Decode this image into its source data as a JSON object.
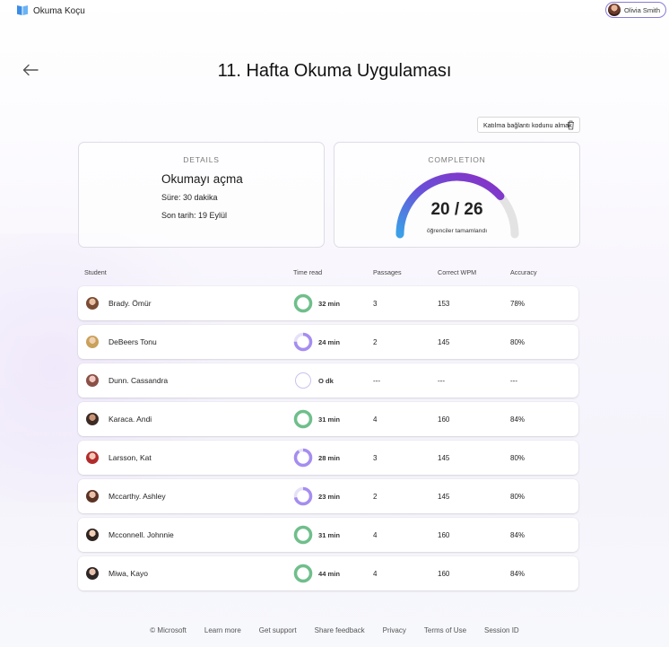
{
  "app": {
    "title": "Okuma Koçu"
  },
  "user": {
    "name": "Olivia Smith"
  },
  "page": {
    "title": "11. Hafta Okuma Uygulaması"
  },
  "actions": {
    "copy_label": "Katılma bağlantı kodunu almak"
  },
  "details": {
    "label": "DETAILS",
    "title": "Okumayı açma",
    "duration": "Süre: 30 dakika",
    "due": "Son tarih: 19 Eylül"
  },
  "completion": {
    "label": "COMPLETION",
    "value": "20 / 26",
    "completed": 20,
    "total": 26,
    "caption": "öğrenciler tamamlandı"
  },
  "table": {
    "headers": {
      "student": "Student",
      "time": "Time read",
      "passages": "Passages",
      "wpm": "Correct WPM",
      "accuracy": "Accuracy"
    },
    "rows": [
      {
        "name": "Brady. Ömür",
        "time": "32 min",
        "passages": "3",
        "wpm": "153",
        "accuracy": "78%",
        "progress": 1.0,
        "color": "#6fbf8a"
      },
      {
        "name": "DeBeers Tonu",
        "time": "24 min",
        "passages": "2",
        "wpm": "145",
        "accuracy": "80%",
        "progress": 0.75,
        "color": "#a58df0"
      },
      {
        "name": "Dunn. Cassandra",
        "time": "O dk",
        "passages": "---",
        "wpm": "---",
        "accuracy": "---",
        "progress": 0.0,
        "color": "#a58df0"
      },
      {
        "name": "Karaca. Andi",
        "time": "31 min",
        "passages": "4",
        "wpm": "160",
        "accuracy": "84%",
        "progress": 1.0,
        "color": "#6fbf8a"
      },
      {
        "name": "Larsson, Kat",
        "time": "28 min",
        "passages": "3",
        "wpm": "145",
        "accuracy": "80%",
        "progress": 0.9,
        "color": "#a58df0"
      },
      {
        "name": "Mccarthy. Ashley",
        "time": "23 min",
        "passages": "2",
        "wpm": "145",
        "accuracy": "80%",
        "progress": 0.72,
        "color": "#a58df0"
      },
      {
        "name": "Mcconnell. Johnnie",
        "time": "31 min",
        "passages": "4",
        "wpm": "160",
        "accuracy": "84%",
        "progress": 1.0,
        "color": "#6fbf8a"
      },
      {
        "name": "Miwa, Kayo",
        "time": "44 min",
        "passages": "4",
        "wpm": "160",
        "accuracy": "84%",
        "progress": 1.0,
        "color": "#6fbf8a"
      }
    ]
  },
  "footer": {
    "links": [
      "© Microsoft",
      "Learn more",
      "Get support",
      "Share feedback",
      "Privacy",
      "Terms of Use",
      "Session ID"
    ]
  }
}
